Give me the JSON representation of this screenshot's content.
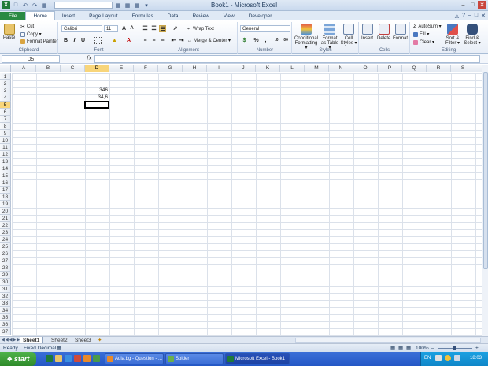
{
  "window": {
    "title": "Book1 - Microsoft Excel"
  },
  "tabs": [
    "File",
    "Home",
    "Insert",
    "Page Layout",
    "Formulas",
    "Data",
    "Review",
    "View",
    "Developer"
  ],
  "active_tab": "Home",
  "ribbon": {
    "clipboard": {
      "paste": "Paste",
      "cut": "Cut",
      "copy": "Copy ▾",
      "format_painter": "Format Painter",
      "label": "Clipboard"
    },
    "font": {
      "name": "Calibri",
      "size": "11",
      "bold": "B",
      "italic": "I",
      "underline": "U",
      "label": "Font"
    },
    "alignment": {
      "wrap_text": "Wrap Text",
      "merge_center": "Merge & Center ▾",
      "label": "Alignment"
    },
    "number": {
      "format": "General",
      "percent": "%",
      "comma": ",",
      "label": "Number"
    },
    "styles": {
      "conditional": "Conditional Formatting ▾",
      "format_table": "Format as Table ▾",
      "cell_styles": "Cell Styles ▾",
      "label": "Styles"
    },
    "cells": {
      "insert": "Insert",
      "delete": "Delete",
      "format": "Format",
      "label": "Cells"
    },
    "editing": {
      "autosum": "AutoSum ▾",
      "fill": "Fill ▾",
      "clear": "Clear ▾",
      "sort_filter": "Sort & Filter ▾",
      "find_select": "Find & Select ▾",
      "label": "Editing"
    }
  },
  "formula_bar": {
    "name_box": "D5",
    "fx": "fx",
    "value": ""
  },
  "columns": [
    "A",
    "B",
    "C",
    "D",
    "E",
    "F",
    "G",
    "H",
    "I",
    "J",
    "K",
    "L",
    "M",
    "N",
    "O",
    "P",
    "Q",
    "R",
    "S"
  ],
  "selected_column": "D",
  "rows": [
    "1",
    "2",
    "3",
    "4",
    "5",
    "6",
    "7",
    "8",
    "9",
    "10",
    "11",
    "12",
    "13",
    "14",
    "15",
    "16",
    "17",
    "18",
    "19",
    "20",
    "21",
    "22",
    "23",
    "24",
    "25",
    "26",
    "27",
    "28",
    "29",
    "30",
    "31",
    "32",
    "33",
    "34",
    "35",
    "36",
    "37"
  ],
  "selected_row": "5",
  "cells": {
    "D3": "346",
    "D4": "34,6"
  },
  "sheets": [
    "Sheet1",
    "Sheet2",
    "Sheet3"
  ],
  "active_sheet": "Sheet1",
  "status": {
    "ready": "Ready",
    "mode": "Fixed Decimal",
    "zoom": "100%"
  },
  "taskbar": {
    "start": "start",
    "tasks": [
      "Aula.bg - Question - ...",
      "Spider",
      "Microsoft Excel - Book1"
    ],
    "lang": "EN",
    "clock": "18:03"
  },
  "colors": {
    "file_tab": "#2a8a43",
    "taskbar": "#2457c5",
    "selection_header": "#f8d57a"
  }
}
